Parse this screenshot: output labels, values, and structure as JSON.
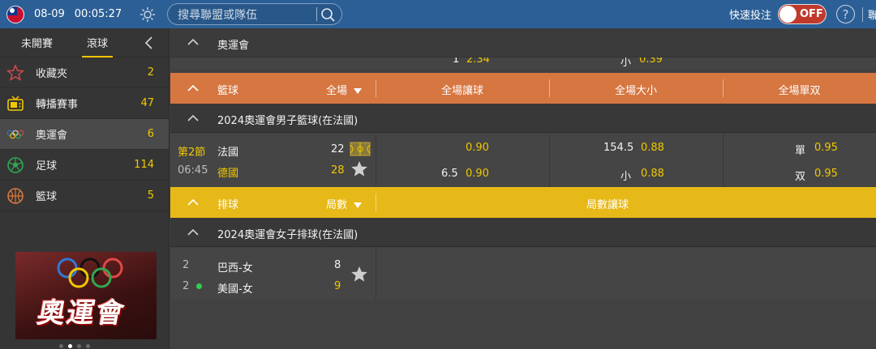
{
  "topbar": {
    "date": "08-09",
    "time": "00:05:27",
    "search_placeholder": "搜尋聯盟或隊伍",
    "quick_bet_label": "快速投注",
    "toggle_state": "OFF",
    "help_label": "?",
    "more_label": "聯"
  },
  "sidebar": {
    "tabs": [
      {
        "label": "未開賽"
      },
      {
        "label": "滾球"
      }
    ],
    "items": [
      {
        "label": "收藏夾",
        "count": "2",
        "icon": "star-icon"
      },
      {
        "label": "轉播賽事",
        "count": "47",
        "icon": "tv-icon"
      },
      {
        "label": "奧運會",
        "count": "6",
        "icon": "olympic-rings-icon"
      },
      {
        "label": "足球",
        "count": "114",
        "icon": "soccer-ball-icon"
      },
      {
        "label": "籃球",
        "count": "5",
        "icon": "basketball-icon"
      }
    ],
    "banner_text": "奧運會"
  },
  "main": {
    "olympic_header": "奧運會",
    "peek": {
      "left": "1",
      "left_odds": "2.34",
      "mid": "小",
      "mid_odds": "0.39"
    },
    "basketball": {
      "sport": "籃球",
      "period_select": "全場",
      "columns": [
        "全場讓球",
        "全場大小",
        "全場單双"
      ],
      "league": "2024奧運會男子籃球(在法國)",
      "match": {
        "period": "第2節",
        "clock": "06:45",
        "team1": "法國",
        "team2": "德國",
        "score1": "22",
        "score2": "28",
        "handicap_line": "6.5",
        "handicap_odds1": "0.90",
        "handicap_odds2": "0.90",
        "total_line": "154.5",
        "total_odds1": "0.88",
        "under_label": "小",
        "total_odds2": "0.88",
        "odd_label": "單",
        "odd_odds": "0.95",
        "even_label": "双",
        "even_odds": "0.95"
      }
    },
    "volleyball": {
      "sport": "排球",
      "period_select": "局數",
      "column": "局數讓球",
      "league": "2024奧運會女子排球(在法國)",
      "match": {
        "set1": "2",
        "set2": "2",
        "team1": "巴西-女",
        "team2": "美國-女",
        "score1": "8",
        "score2": "9"
      }
    }
  },
  "colors": {
    "topbar": "#2c5f95",
    "basketball_bar": "#d67641",
    "volleyball_bar": "#e7b918",
    "odds_yellow": "#f0c800"
  }
}
